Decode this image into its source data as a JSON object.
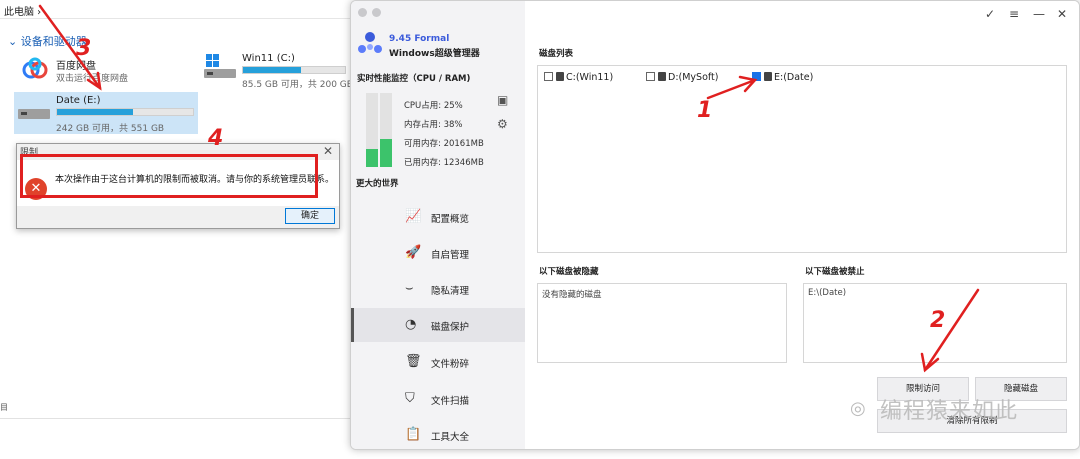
{
  "explorer": {
    "breadcrumb": "此电脑 ›",
    "section": "⌄ 设备和驱动器",
    "tiny": "目",
    "drives": [
      {
        "name": "百度网盘",
        "info": "双击运行百度网盘"
      },
      {
        "name": "Win11 (C:)",
        "info": "85.5 GB 可用，共 200 GB",
        "used": 0.57
      },
      {
        "name": "Date (E:)",
        "info": "242 GB 可用，共 551 GB",
        "used": 0.56
      }
    ]
  },
  "dialog": {
    "title": "限制",
    "close": "✕",
    "message": "本次操作由于这台计算机的限制而被取消。请与你的系统管理员联系。",
    "ok": "确定"
  },
  "app": {
    "version": "9.45 Formal",
    "name": "Windows超级管理器",
    "perf_title": "实时性能监控（CPU / RAM)",
    "cpu": "CPU占用: 25%",
    "mem": "内存占用: 38%",
    "avail": "可用内存: 20161MB",
    "used": "已用内存: 12346MB",
    "cpu_level": 0.25,
    "mem_level": 0.38,
    "world": "更大的世界",
    "nav": [
      {
        "label": "配置概览",
        "icon": "chart-icon"
      },
      {
        "label": "自启管理",
        "icon": "rocket-icon"
      },
      {
        "label": "隐私清理",
        "icon": "eye-closed-icon"
      },
      {
        "label": "磁盘保护",
        "icon": "pie-icon"
      },
      {
        "label": "文件粉碎",
        "icon": "trash-icon"
      },
      {
        "label": "文件扫描",
        "icon": "shield-icon"
      },
      {
        "label": "工具大全",
        "icon": "clipboard-icon"
      }
    ],
    "window_controls": {
      "check": "✓",
      "menu": "≡",
      "min": "—",
      "close": "✕"
    },
    "disk_list_title": "磁盘列表",
    "disks": [
      {
        "label": "C:(Win11)",
        "checked": false
      },
      {
        "label": "D:(MySoft)",
        "checked": false
      },
      {
        "label": "E:(Date)",
        "checked": true
      }
    ],
    "hidden_title": "以下磁盘被隐藏",
    "hidden_text": "没有隐藏的磁盘",
    "blocked_title": "以下磁盘被禁止",
    "blocked_text": "E:\\(Date)",
    "btn_restrict": "限制访问",
    "btn_hide": "隐藏磁盘",
    "btn_clear": "清除所有限制"
  },
  "annotations": [
    "1",
    "2",
    "3",
    "4"
  ],
  "watermark": "编程猿来如此",
  "colors": {
    "accent": "#3b5bdb",
    "annotation": "#e02020",
    "gauge": "#3cc36b",
    "error": "#e0432b"
  }
}
